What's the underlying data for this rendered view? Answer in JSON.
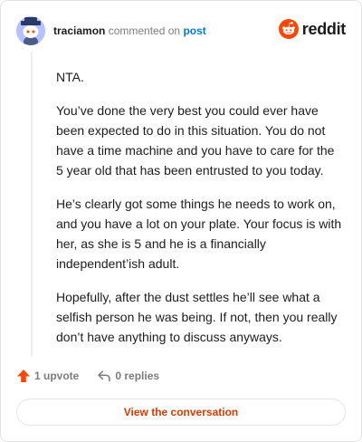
{
  "header": {
    "author": "traciamon",
    "action_text": "commented on",
    "post_link": "post",
    "avatar_icon": "snoo-avatar-icon"
  },
  "brand": {
    "wordmark": "reddit",
    "logo_icon": "reddit-alien-icon",
    "accent_color": "#ff4500"
  },
  "comment": {
    "paragraphs": [
      "NTA.",
      "You’ve done the very best you could ever have been expected to do in this situation. You do not have a time machine and you have to care for the 5 year old that has been entrusted to you today.",
      "He’s clearly got some things he needs to work on, and you have a lot on your plate. Your focus is with her, as she is 5 and he is a financially independent’ish adult.",
      "Hopefully, after the dust settles he’ll see what a selfish person he was being. If not, then you really don’t have anything to discuss anyways."
    ]
  },
  "actions": {
    "upvote_label": "1 upvote",
    "upvote_icon": "upvote-arrow-icon",
    "upvote_color": "#ff4500",
    "replies_label": "0 replies",
    "replies_icon": "reply-arrow-icon"
  },
  "footer": {
    "view_conversation_label": "View the conversation",
    "button_text_color": "#d93a00"
  }
}
